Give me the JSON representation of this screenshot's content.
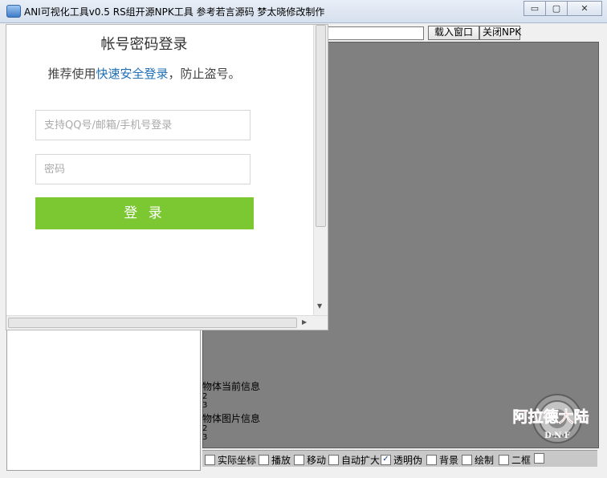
{
  "window": {
    "title": "ANI可视化工具v0.5 RS组开源NPK工具 参考若言源码 梦太晓修改制作",
    "min_label": "▭",
    "max_label": "▢",
    "close_label": "✕"
  },
  "toolbar": {
    "load_label": "载入窗口",
    "close_npk_label": "关闭NPK"
  },
  "login": {
    "title": "帐号密码登录",
    "subtitle_prefix": "推荐使用",
    "subtitle_link": "快速安全登录",
    "subtitle_suffix": "，防止盗号。",
    "account_placeholder": "支持QQ号/邮箱/手机号登录",
    "password_placeholder": "密码",
    "submit_label": "登 录"
  },
  "info": {
    "current_label": "物体当前信息",
    "current_values": [
      "2",
      "3"
    ],
    "image_label": "物体图片信息",
    "image_values": [
      "2",
      "3"
    ]
  },
  "logo": {
    "text": "阿拉德大陆",
    "subtext": "D·N·F"
  },
  "options": [
    {
      "label": "实际坐标",
      "checked": false
    },
    {
      "label": "播放",
      "checked": false
    },
    {
      "label": "移动",
      "checked": false
    },
    {
      "label": "自动扩大",
      "checked": false
    },
    {
      "label": "透明伪",
      "checked": true
    },
    {
      "label": "背景",
      "checked": false
    },
    {
      "label": "绘制",
      "checked": false
    },
    {
      "label": "二框",
      "checked": false
    },
    {
      "label": "",
      "checked": false
    }
  ]
}
